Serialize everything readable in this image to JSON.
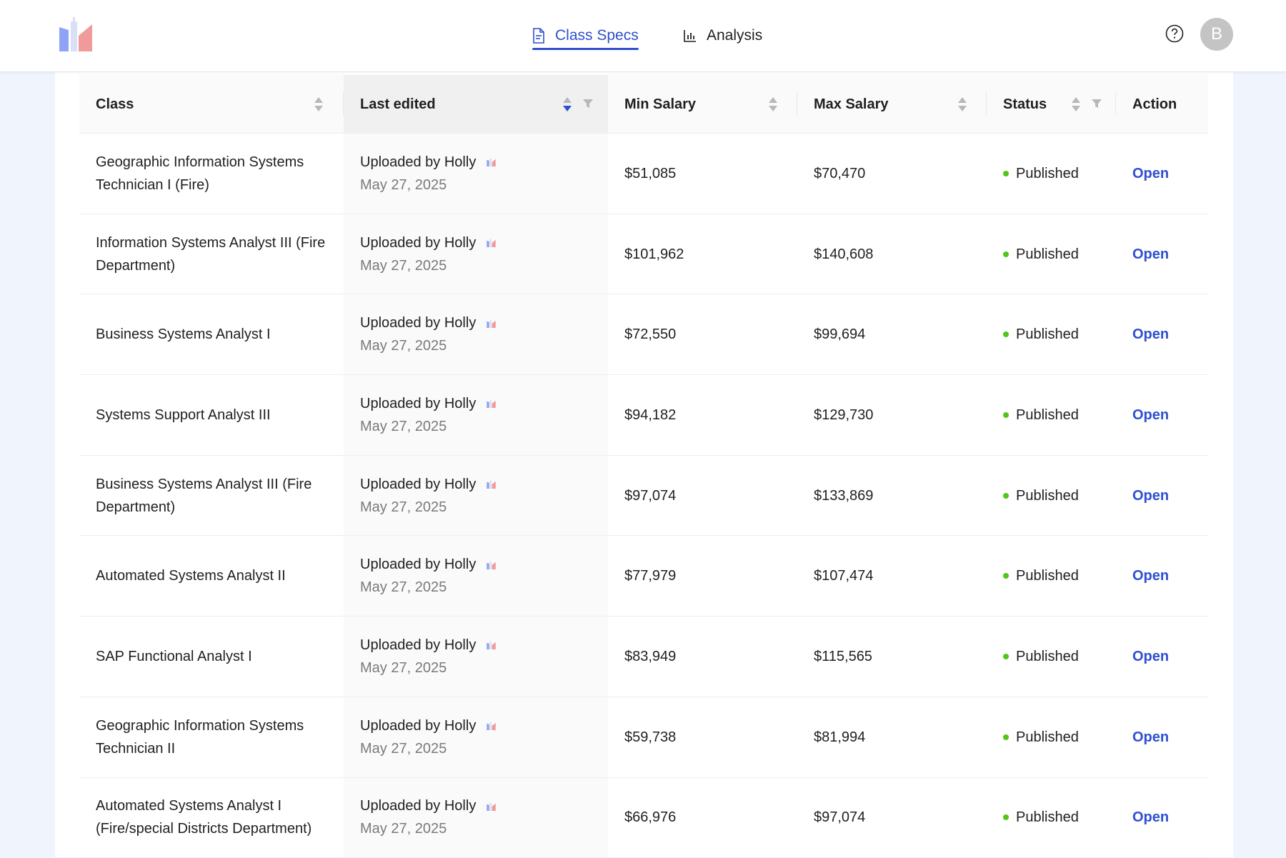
{
  "header": {
    "nav": [
      {
        "label": "Class Specs",
        "icon": "document-icon",
        "active": true
      },
      {
        "label": "Analysis",
        "icon": "bar-chart-icon",
        "active": false
      }
    ],
    "avatar_initial": "B"
  },
  "colors": {
    "accent": "#2f4fd1",
    "published": "#52c41a",
    "logo_blue": "#7b93f2",
    "logo_red": "#f07b7b"
  },
  "table": {
    "columns": [
      "Class",
      "Last edited",
      "Min Salary",
      "Max Salary",
      "Status",
      "Action"
    ],
    "rows": [
      {
        "cls": "Geographic Information Systems Technician I (Fire)",
        "uploaded": "Uploaded by Holly",
        "date": "May 27, 2025",
        "min": "$51,085",
        "max": "$70,470",
        "status": "Published",
        "action": "Open"
      },
      {
        "cls": "Information Systems Analyst III (Fire Department)",
        "uploaded": "Uploaded by Holly",
        "date": "May 27, 2025",
        "min": "$101,962",
        "max": "$140,608",
        "status": "Published",
        "action": "Open"
      },
      {
        "cls": "Business Systems Analyst I",
        "uploaded": "Uploaded by Holly",
        "date": "May 27, 2025",
        "min": "$72,550",
        "max": "$99,694",
        "status": "Published",
        "action": "Open"
      },
      {
        "cls": "Systems Support Analyst III",
        "uploaded": "Uploaded by Holly",
        "date": "May 27, 2025",
        "min": "$94,182",
        "max": "$129,730",
        "status": "Published",
        "action": "Open"
      },
      {
        "cls": "Business Systems Analyst III (Fire Department)",
        "uploaded": "Uploaded by Holly",
        "date": "May 27, 2025",
        "min": "$97,074",
        "max": "$133,869",
        "status": "Published",
        "action": "Open"
      },
      {
        "cls": "Automated Systems Analyst II",
        "uploaded": "Uploaded by Holly",
        "date": "May 27, 2025",
        "min": "$77,979",
        "max": "$107,474",
        "status": "Published",
        "action": "Open"
      },
      {
        "cls": "SAP Functional Analyst I",
        "uploaded": "Uploaded by Holly",
        "date": "May 27, 2025",
        "min": "$83,949",
        "max": "$115,565",
        "status": "Published",
        "action": "Open"
      },
      {
        "cls": "Geographic Information Systems Technician II",
        "uploaded": "Uploaded by Holly",
        "date": "May 27, 2025",
        "min": "$59,738",
        "max": "$81,994",
        "status": "Published",
        "action": "Open"
      },
      {
        "cls": "Automated Systems Analyst I (Fire/special Districts Department)",
        "uploaded": "Uploaded by Holly",
        "date": "May 27, 2025",
        "min": "$66,976",
        "max": "$97,074",
        "status": "Published",
        "action": "Open"
      }
    ]
  }
}
